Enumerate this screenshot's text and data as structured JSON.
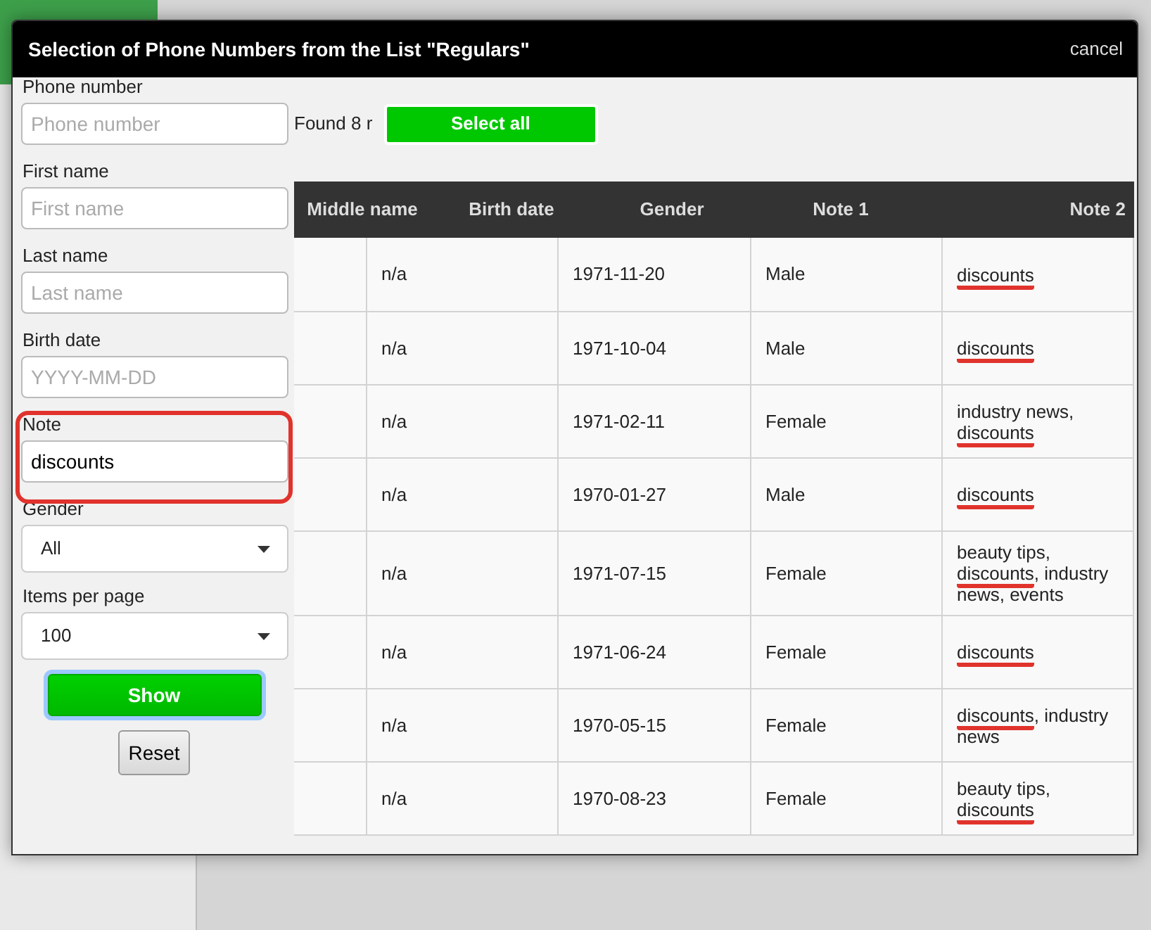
{
  "dialog": {
    "title": "Selection of Phone Numbers from the List \"Regulars\"",
    "close_link": "cancel"
  },
  "filters": [
    {
      "kind": "text",
      "label": "Phone number",
      "placeholder": "Phone number",
      "highlighted": false
    },
    {
      "kind": "text",
      "label": "First name",
      "placeholder": "First name",
      "highlighted": false
    },
    {
      "kind": "text",
      "label": "Last name",
      "placeholder": "Last name",
      "highlighted": false
    },
    {
      "kind": "text",
      "label": "Birth date",
      "placeholder": "YYYY-MM-DD",
      "highlighted": false
    },
    {
      "kind": "text",
      "label": "Note",
      "value": "discounts",
      "highlighted": true
    },
    {
      "kind": "select",
      "label": "Gender",
      "value": "All",
      "highlighted": false
    },
    {
      "kind": "select",
      "label": "Items per page",
      "value": "100",
      "highlighted": false
    }
  ],
  "show_button": {
    "label": "Show",
    "focused": true
  },
  "reset_button": {
    "label": "Reset"
  },
  "found_text": "Found 8 r",
  "select_all_button": {
    "label": "Select all"
  },
  "table": {
    "columns": [
      "Middle name",
      "Birth date",
      "Gender",
      "Note 1",
      "Note 2"
    ],
    "rows": [
      {
        "cells": [
          "n/a",
          "1971-11-20",
          "Male"
        ],
        "note": [
          {
            "text": "discounts",
            "underlined": true
          }
        ]
      },
      {
        "cells": [
          "n/a",
          "1971-10-04",
          "Male"
        ],
        "note": [
          {
            "text": "discounts",
            "underlined": true
          }
        ]
      },
      {
        "cells": [
          "n/a",
          "1971-02-11",
          "Female"
        ],
        "note": [
          {
            "text": "industry news, ",
            "underlined": false
          },
          {
            "text": "discounts",
            "underlined": true
          }
        ]
      },
      {
        "cells": [
          "n/a",
          "1970-01-27",
          "Male"
        ],
        "note": [
          {
            "text": "discounts",
            "underlined": true
          }
        ]
      },
      {
        "cells": [
          "n/a",
          "1971-07-15",
          "Female"
        ],
        "note": [
          {
            "text": "beauty tips, ",
            "underlined": false
          },
          {
            "text": "discounts",
            "underlined": true
          },
          {
            "text": ", industry news, events",
            "underlined": false
          }
        ]
      },
      {
        "cells": [
          "n/a",
          "1971-06-24",
          "Female"
        ],
        "note": [
          {
            "text": "discounts",
            "underlined": true
          }
        ]
      },
      {
        "cells": [
          "n/a",
          "1970-05-15",
          "Female"
        ],
        "note": [
          {
            "text": "discounts",
            "underlined": true
          },
          {
            "text": ", industry news",
            "underlined": false
          }
        ]
      },
      {
        "cells": [
          "n/a",
          "1970-08-23",
          "Female"
        ],
        "note": [
          {
            "text": "beauty tips, ",
            "underlined": false
          },
          {
            "text": "discounts",
            "underlined": true
          }
        ]
      }
    ]
  }
}
